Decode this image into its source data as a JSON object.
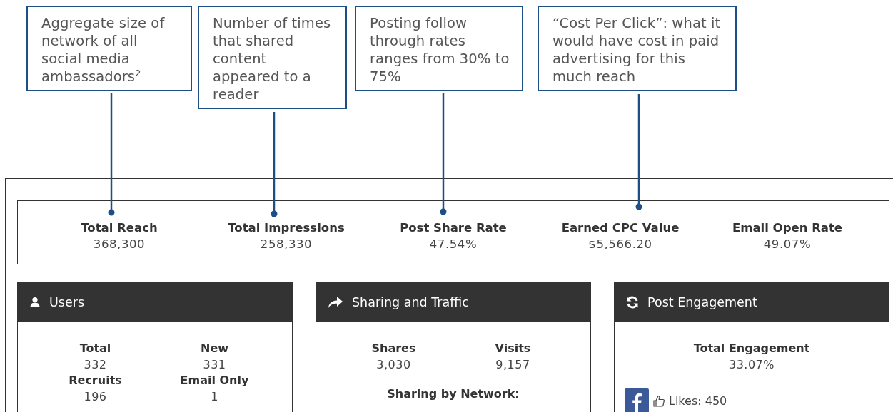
{
  "callouts": [
    {
      "text": "Aggregate size of network of all social media ambassadors$^{2}$"
    },
    {
      "text": "Number of times that shared content appeared to a reader"
    },
    {
      "text": "Posting follow through rates ranges from 30% to 75%"
    },
    {
      "text": "“Cost Per Click”: what it would have cost in paid advertising for this much reach"
    }
  ],
  "metrics": [
    {
      "label": "Total Reach",
      "value": "368,300"
    },
    {
      "label": "Total Impressions",
      "value": "258,330"
    },
    {
      "label": "Post Share Rate",
      "value": "47.54%"
    },
    {
      "label": "Earned CPC Value",
      "value": "$5,566.20"
    },
    {
      "label": "Email Open Rate",
      "value": "49.07%"
    }
  ],
  "panels": [
    {
      "kind": "users",
      "title": "Users",
      "stats": [
        {
          "label": "Total",
          "value": "332"
        },
        {
          "label": "New",
          "value": "331"
        },
        {
          "label": "Recruits",
          "value": "196"
        },
        {
          "label": "Email Only",
          "value": "1"
        }
      ]
    },
    {
      "kind": "sharing",
      "title": "Sharing and Traffic",
      "stats": [
        {
          "label": "Shares",
          "value": "3,030"
        },
        {
          "label": "Visits",
          "value": "9,157"
        }
      ],
      "subheading": "Sharing by Network:"
    },
    {
      "kind": "engagement",
      "title": "Post Engagement",
      "stats": [
        {
          "label": "Total Engagement",
          "value": "33.07%"
        }
      ],
      "likes": "Likes: 450"
    }
  ]
}
